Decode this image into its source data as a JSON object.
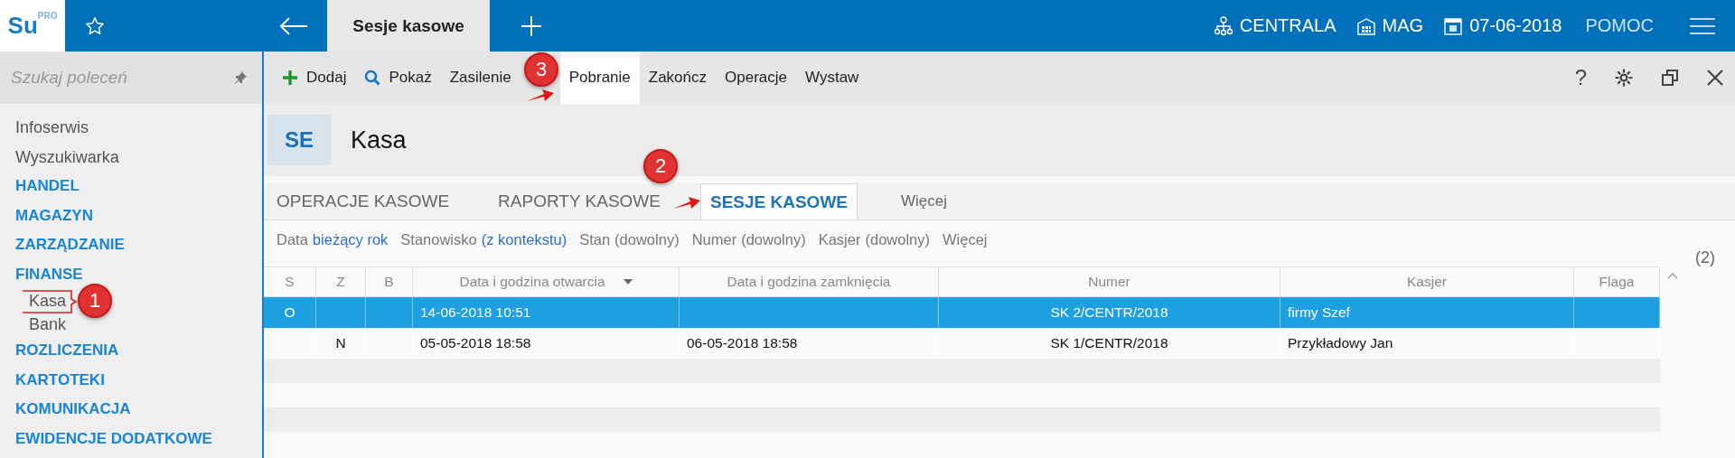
{
  "logo": {
    "text": "Su",
    "sup": "PRO"
  },
  "top_tab": {
    "label": "Sesje kasowe",
    "selected": true
  },
  "top_nav": [
    {
      "kind": "network",
      "label": "CENTRALA"
    },
    {
      "kind": "warehouse",
      "label": "MAG"
    },
    {
      "kind": "calendar",
      "label": "07-06-2018"
    },
    {
      "kind": "plain",
      "label": "POMOC"
    }
  ],
  "sidebar": {
    "search": {
      "placeholder": "Szukaj poleceń"
    },
    "items": [
      {
        "label": "Infoserwis",
        "kind": "link"
      },
      {
        "label": "Wyszukiwarka",
        "kind": "link"
      },
      {
        "label": "HANDEL",
        "kind": "section"
      },
      {
        "label": "MAGAZYN",
        "kind": "section"
      },
      {
        "label": "ZARZĄDZANIE",
        "kind": "section"
      },
      {
        "label": "FINANSE",
        "kind": "section",
        "children": [
          {
            "label": "Kasa"
          },
          {
            "label": "Bank"
          }
        ]
      },
      {
        "label": "ROZLICZENIA",
        "kind": "section"
      },
      {
        "label": "KARTOTEKI",
        "kind": "section"
      },
      {
        "label": "KOMUNIKACJA",
        "kind": "section"
      },
      {
        "label": "EWIDENCJE DODATKOWE",
        "kind": "section"
      }
    ]
  },
  "toolbar": {
    "buttons": [
      {
        "label": "Dodaj",
        "kind": "add",
        "selected": false
      },
      {
        "label": "Pokaż",
        "kind": "search",
        "selected": false
      },
      {
        "label": "Zasilenie",
        "kind": "plain",
        "selected": false
      },
      {
        "label": "Pobranie",
        "kind": "plain",
        "selected": true
      },
      {
        "label": "Zakończ",
        "kind": "plain",
        "selected": false
      },
      {
        "label": "Operacje",
        "kind": "plain",
        "selected": false
      },
      {
        "label": "Wystaw",
        "kind": "plain",
        "selected": false
      }
    ],
    "help_label": "?"
  },
  "header": {
    "badge": "SE",
    "title": "Kasa"
  },
  "tabs": [
    {
      "label": "OPERACJE KASOWE",
      "selected": false
    },
    {
      "label": "RAPORTY KASOWE",
      "selected": false
    },
    {
      "label": "SESJE KASOWE",
      "selected": true
    },
    {
      "label": "Więcej",
      "selected": false
    }
  ],
  "filters": [
    {
      "label": "Data",
      "value": "bieżący rok",
      "set": true
    },
    {
      "label": "Stanowisko",
      "value": "(z kontekstu)",
      "set": true
    },
    {
      "label": "Stan",
      "value": "(dowolny)",
      "set": false
    },
    {
      "label": "Numer",
      "value": "(dowolny)",
      "set": false
    },
    {
      "label": "Kasjer",
      "value": "(dowolny)",
      "set": false
    }
  ],
  "more_filters": "Więcej",
  "count": "(2)",
  "table": {
    "columns": [
      {
        "label": "S",
        "sorted": false
      },
      {
        "label": "Z",
        "sorted": false
      },
      {
        "label": "B",
        "sorted": false
      },
      {
        "label": "Data i godzina otwarcia",
        "sorted": true
      },
      {
        "label": "Data i godzina zamknięcia",
        "sorted": false
      },
      {
        "label": "Numer",
        "sorted": false
      },
      {
        "label": "Kasjer",
        "sorted": false
      },
      {
        "label": "Flaga",
        "sorted": false
      }
    ],
    "rows": [
      {
        "cells": [
          "O",
          "",
          "",
          "14-06-2018  10:51",
          "",
          "SK 2/CENTR/2018",
          "firmy Szef",
          ""
        ],
        "selected": true
      },
      {
        "cells": [
          "",
          "N",
          "",
          "05-05-2018  18:58",
          "06-05-2018  18:58",
          "SK 1/CENTR/2018",
          "Przykładowy Jan",
          ""
        ],
        "selected": false
      }
    ]
  },
  "annotations": [
    "1",
    "2",
    "3"
  ]
}
